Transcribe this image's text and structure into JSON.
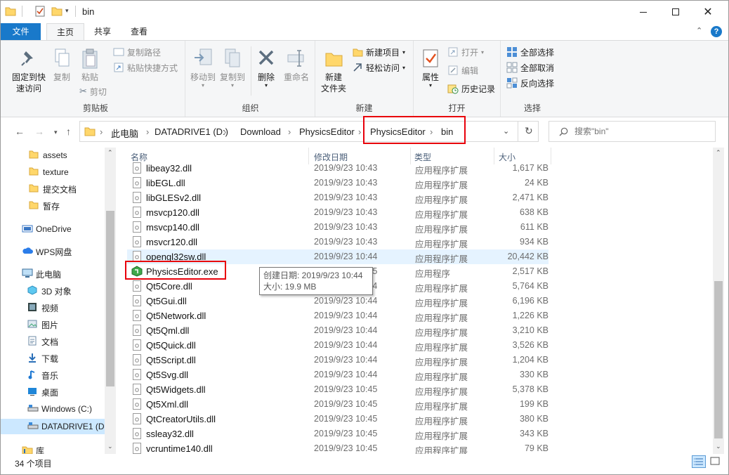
{
  "window": {
    "title": "bin"
  },
  "ribbon_tabs": [
    "文件",
    "主页",
    "共享",
    "查看"
  ],
  "ribbon": {
    "clipboard": {
      "label": "剪贴板",
      "pin": "固定到快\n速访问",
      "copy": "复制",
      "paste": "粘贴",
      "copy_path": "复制路径",
      "paste_shortcut": "粘贴快捷方式",
      "cut": "剪切"
    },
    "organize": {
      "label": "组织",
      "move_to": "移动到",
      "copy_to": "复制到",
      "delete": "删除",
      "rename": "重命名"
    },
    "new": {
      "label": "新建",
      "new_folder": "新建\n文件夹",
      "new_item": "新建项目",
      "easy_access": "轻松访问"
    },
    "open": {
      "label": "打开",
      "properties": "属性",
      "open": "打开",
      "edit": "编辑",
      "history": "历史记录"
    },
    "select": {
      "label": "选择",
      "select_all": "全部选择",
      "select_none": "全部取消",
      "invert": "反向选择"
    }
  },
  "address": {
    "crumbs": [
      "此电脑",
      "DATADRIVE1 (D:)",
      "Download",
      "PhysicsEditor",
      "PhysicsEditor",
      "bin"
    ]
  },
  "search": {
    "placeholder": "搜索\"bin\""
  },
  "nav": [
    {
      "label": "assets",
      "icon": "folder-icon"
    },
    {
      "label": "texture",
      "icon": "folder-icon"
    },
    {
      "label": "提交文档",
      "icon": "folder-icon"
    },
    {
      "label": "暂存",
      "icon": "folder-icon"
    },
    {
      "label": "OneDrive",
      "icon": "onedrive-icon"
    },
    {
      "label": "WPS网盘",
      "icon": "cloud-icon"
    },
    {
      "label": "此电脑",
      "icon": "pc-icon"
    },
    {
      "label": "3D 对象",
      "icon": "3d-icon"
    },
    {
      "label": "视频",
      "icon": "video-icon"
    },
    {
      "label": "图片",
      "icon": "picture-icon"
    },
    {
      "label": "文档",
      "icon": "document-icon"
    },
    {
      "label": "下载",
      "icon": "download-icon"
    },
    {
      "label": "音乐",
      "icon": "music-icon"
    },
    {
      "label": "桌面",
      "icon": "desktop-icon"
    },
    {
      "label": "Windows  (C:)",
      "icon": "drive-icon"
    },
    {
      "label": "DATADRIVE1 (D",
      "icon": "drive-icon"
    },
    {
      "label": "库",
      "icon": "library-icon"
    }
  ],
  "columns": {
    "name": "名称",
    "date": "修改日期",
    "type": "类型",
    "size": "大小"
  },
  "files": [
    {
      "name": "libeay32.dll",
      "date": "2019/9/23 10:43",
      "type": "应用程序扩展",
      "size": "1,617 KB"
    },
    {
      "name": "libEGL.dll",
      "date": "2019/9/23 10:43",
      "type": "应用程序扩展",
      "size": "24 KB"
    },
    {
      "name": "libGLESv2.dll",
      "date": "2019/9/23 10:43",
      "type": "应用程序扩展",
      "size": "2,471 KB"
    },
    {
      "name": "msvcp120.dll",
      "date": "2019/9/23 10:43",
      "type": "应用程序扩展",
      "size": "638 KB"
    },
    {
      "name": "msvcp140.dll",
      "date": "2019/9/23 10:43",
      "type": "应用程序扩展",
      "size": "611 KB"
    },
    {
      "name": "msvcr120.dll",
      "date": "2019/9/23 10:43",
      "type": "应用程序扩展",
      "size": "934 KB"
    },
    {
      "name": "opengl32sw.dll",
      "date": "2019/9/23 10:44",
      "type": "应用程序扩展",
      "size": "20,442 KB"
    },
    {
      "name": "PhysicsEditor.exe",
      "date": "2019/9/23 10:45",
      "type": "应用程序",
      "size": "2,517 KB"
    },
    {
      "name": "Qt5Core.dll",
      "date": "2019/9/23 10:44",
      "type": "应用程序扩展",
      "size": "5,764 KB"
    },
    {
      "name": "Qt5Gui.dll",
      "date": "2019/9/23 10:44",
      "type": "应用程序扩展",
      "size": "6,196 KB"
    },
    {
      "name": "Qt5Network.dll",
      "date": "2019/9/23 10:44",
      "type": "应用程序扩展",
      "size": "1,226 KB"
    },
    {
      "name": "Qt5Qml.dll",
      "date": "2019/9/23 10:44",
      "type": "应用程序扩展",
      "size": "3,210 KB"
    },
    {
      "name": "Qt5Quick.dll",
      "date": "2019/9/23 10:44",
      "type": "应用程序扩展",
      "size": "3,526 KB"
    },
    {
      "name": "Qt5Script.dll",
      "date": "2019/9/23 10:44",
      "type": "应用程序扩展",
      "size": "1,204 KB"
    },
    {
      "name": "Qt5Svg.dll",
      "date": "2019/9/23 10:44",
      "type": "应用程序扩展",
      "size": "330 KB"
    },
    {
      "name": "Qt5Widgets.dll",
      "date": "2019/9/23 10:45",
      "type": "应用程序扩展",
      "size": "5,378 KB"
    },
    {
      "name": "Qt5Xml.dll",
      "date": "2019/9/23 10:45",
      "type": "应用程序扩展",
      "size": "199 KB"
    },
    {
      "name": "QtCreatorUtils.dll",
      "date": "2019/9/23 10:45",
      "type": "应用程序扩展",
      "size": "380 KB"
    },
    {
      "name": "ssleay32.dll",
      "date": "2019/9/23 10:45",
      "type": "应用程序扩展",
      "size": "343 KB"
    },
    {
      "name": "vcruntime140.dll",
      "date": "2019/9/23 10:45",
      "type": "应用程序扩展",
      "size": "79 KB"
    }
  ],
  "tooltip": {
    "line1": "创建日期: 2019/9/23 10:44",
    "line2": "大小: 19.9 MB"
  },
  "status": {
    "count": "34 个项目"
  },
  "colors": {
    "accent": "#1979ca",
    "highlight": "#e8000b",
    "selection": "#cce8ff"
  }
}
